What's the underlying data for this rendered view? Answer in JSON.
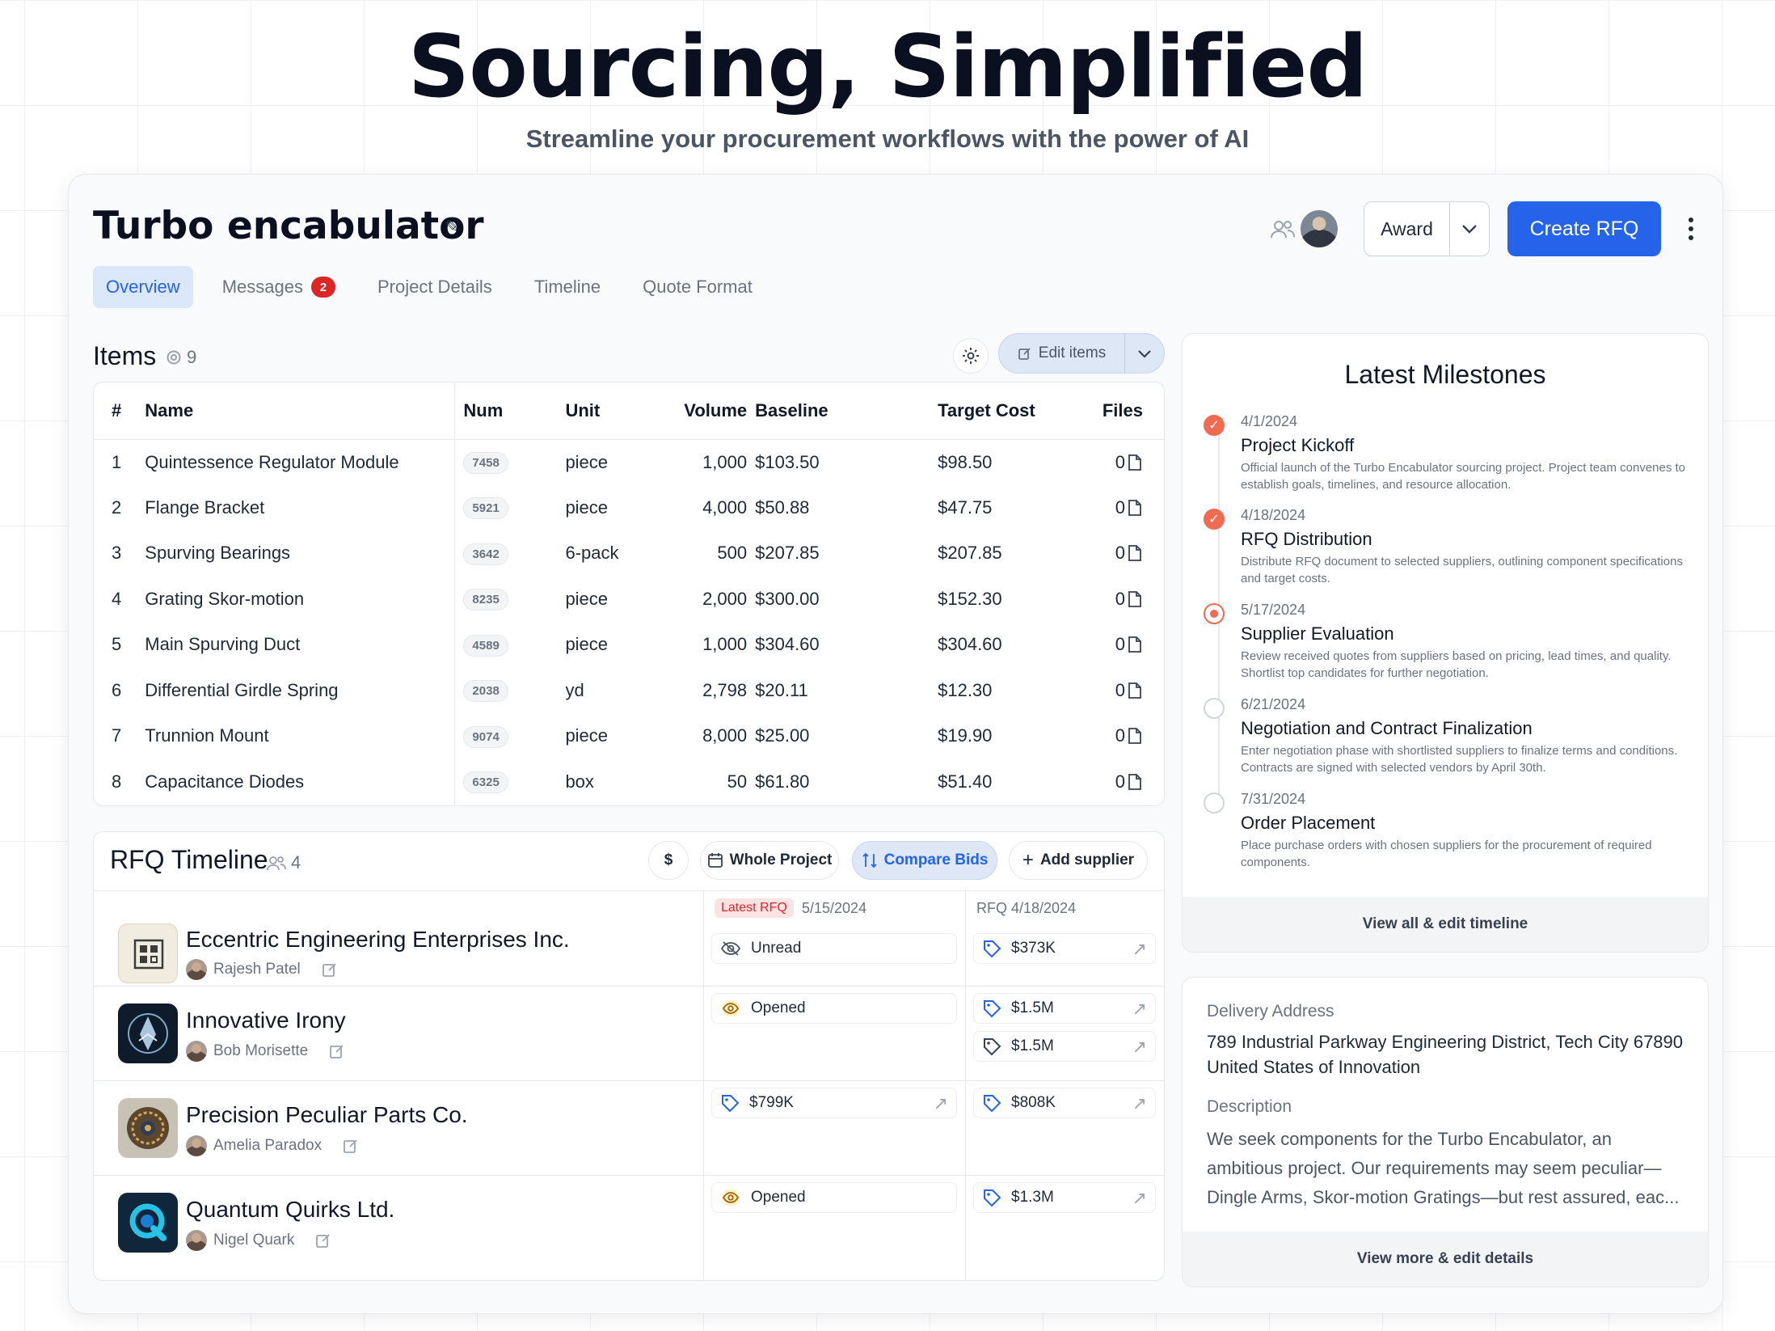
{
  "hero": {
    "title": "Sourcing, Simplified",
    "subtitle": "Streamline your procurement workflows with the power of AI"
  },
  "project": {
    "title": "Turbo encabulator",
    "award_label": "Award",
    "create_rfq_label": "Create RFQ"
  },
  "tabs": [
    {
      "label": "Overview",
      "active": true
    },
    {
      "label": "Messages",
      "badge": "2"
    },
    {
      "label": "Project Details"
    },
    {
      "label": "Timeline"
    },
    {
      "label": "Quote Format"
    }
  ],
  "items": {
    "title": "Items",
    "count": "9",
    "edit_label": "Edit items",
    "columns": {
      "num": "#",
      "name": "Name",
      "code": "Num",
      "unit": "Unit",
      "volume": "Volume",
      "baseline": "Baseline",
      "target": "Target Cost",
      "files": "Files"
    },
    "rows": [
      {
        "n": "1",
        "name": "Quintessence Regulator Module",
        "code": "7458",
        "unit": "piece",
        "volume": "1,000",
        "baseline": "$103.50",
        "target": "$98.50",
        "files": "0"
      },
      {
        "n": "2",
        "name": "Flange Bracket",
        "code": "5921",
        "unit": "piece",
        "volume": "4,000",
        "baseline": "$50.88",
        "target": "$47.75",
        "files": "0"
      },
      {
        "n": "3",
        "name": "Spurving Bearings",
        "code": "3642",
        "unit": "6-pack",
        "volume": "500",
        "baseline": "$207.85",
        "target": "$207.85",
        "files": "0"
      },
      {
        "n": "4",
        "name": "Grating Skor-motion",
        "code": "8235",
        "unit": "piece",
        "volume": "2,000",
        "baseline": "$300.00",
        "target": "$152.30",
        "files": "0"
      },
      {
        "n": "5",
        "name": "Main Spurving Duct",
        "code": "4589",
        "unit": "piece",
        "volume": "1,000",
        "baseline": "$304.60",
        "target": "$304.60",
        "files": "0"
      },
      {
        "n": "6",
        "name": "Differential Girdle Spring",
        "code": "2038",
        "unit": "yd",
        "volume": "2,798",
        "baseline": "$20.11",
        "target": "$12.30",
        "files": "0"
      },
      {
        "n": "7",
        "name": "Trunnion Mount",
        "code": "9074",
        "unit": "piece",
        "volume": "8,000",
        "baseline": "$25.00",
        "target": "$19.90",
        "files": "0"
      },
      {
        "n": "8",
        "name": "Capacitance Diodes",
        "code": "6325",
        "unit": "box",
        "volume": "50",
        "baseline": "$61.80",
        "target": "$51.40",
        "files": "0"
      }
    ]
  },
  "rfq": {
    "title": "RFQ Timeline",
    "count": "4",
    "currency_label": "$",
    "whole_project_label": "Whole Project",
    "compare_bids_label": "Compare Bids",
    "add_supplier_label": "Add supplier",
    "latest_tag": "Latest RFQ",
    "latest_date": "5/15/2024",
    "prev_label": "RFQ 4/18/2024",
    "suppliers": [
      {
        "name": "Eccentric Engineering Enterprises Inc.",
        "contact": "Rajesh Patel",
        "latest": "Unread",
        "prev": [
          "$373K"
        ]
      },
      {
        "name": "Innovative Irony",
        "contact": "Bob Morisette",
        "latest": "Opened",
        "prev": [
          "$1.5M",
          "$1.5M"
        ]
      },
      {
        "name": "Precision Peculiar Parts Co.",
        "contact": "Amelia Paradox",
        "latest": "$799K",
        "prev": [
          "$808K"
        ]
      },
      {
        "name": "Quantum Quirks Ltd.",
        "contact": "Nigel Quark",
        "latest": "Opened",
        "prev": [
          "$1.3M"
        ]
      }
    ]
  },
  "milestones": {
    "title": "Latest Milestones",
    "items": [
      {
        "date": "4/1/2024",
        "name": "Project Kickoff",
        "desc": "Official launch of the Turbo Encabulator sourcing project. Project team convenes to establish goals, timelines, and resource allocation.",
        "state": "done"
      },
      {
        "date": "4/18/2024",
        "name": "RFQ Distribution",
        "desc": "Distribute RFQ document to selected suppliers, outlining component specifications and target costs.",
        "state": "done"
      },
      {
        "date": "5/17/2024",
        "name": "Supplier Evaluation",
        "desc": "Review received quotes from suppliers based on pricing, lead times, and quality. Shortlist top candidates for further negotiation.",
        "state": "current"
      },
      {
        "date": "6/21/2024",
        "name": "Negotiation and Contract Finalization",
        "desc": "Enter negotiation phase with shortlisted suppliers to finalize terms and conditions. Contracts are signed with selected vendors by April 30th.",
        "state": "todo"
      },
      {
        "date": "7/31/2024",
        "name": "Order Placement",
        "desc": "Place purchase orders with chosen suppliers for the procurement of required components.",
        "state": "todo"
      }
    ],
    "footer_label": "View all & edit timeline"
  },
  "details": {
    "address_label": "Delivery Address",
    "address": "789 Industrial Parkway Engineering District, Tech City 67890 United States of Innovation",
    "description_label": "Description",
    "description_lines": [
      "We seek components for the Turbo Encabulator, an",
      "ambitious project. Our requirements may seem peculiar—",
      "Dingle Arms, Skor-motion Gratings—but rest assured, eac..."
    ],
    "footer_label": "View more & edit details"
  },
  "colors": {
    "accent": "#2563eb",
    "milestone_done": "#f06b51",
    "badge": "#dc2626"
  }
}
